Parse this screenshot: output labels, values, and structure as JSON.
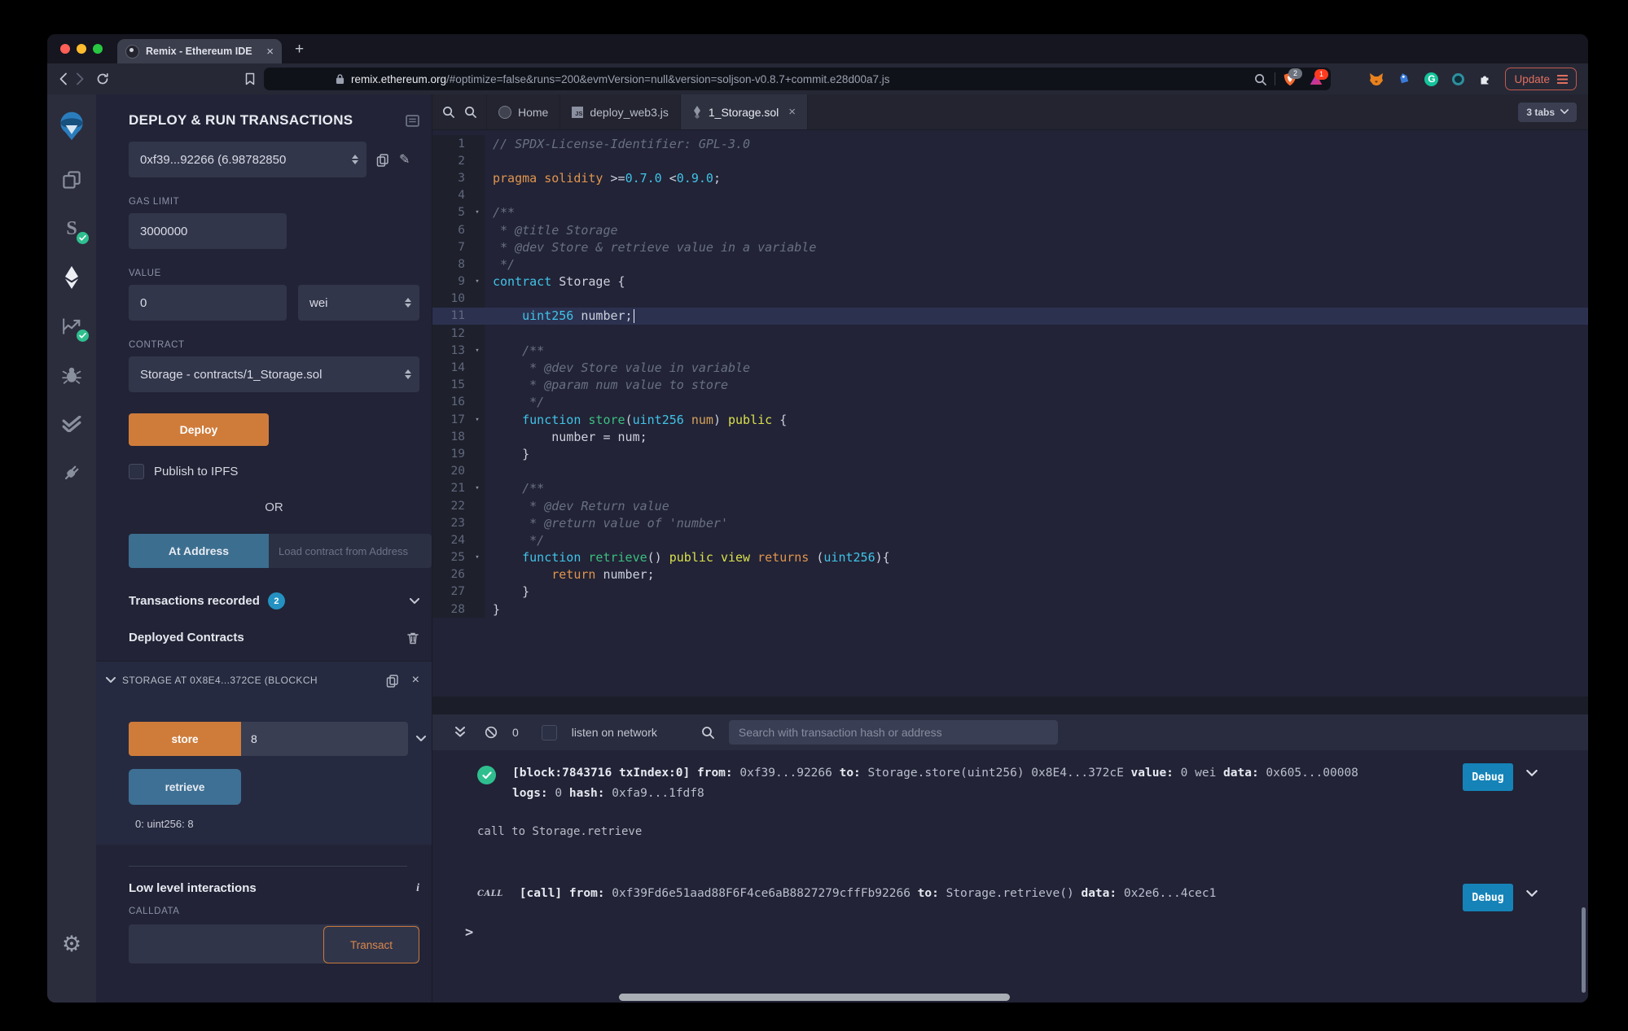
{
  "browser": {
    "traffic_lights": [
      "#ff5f57",
      "#febc2e",
      "#28c840"
    ],
    "tab_title": "Remix - Ethereum IDE",
    "tab_close": "×",
    "new_tab": "+",
    "url": {
      "domain": "remix.ethereum.org",
      "path": "/#optimize=false&runs=200&evmVersion=null&version=soljson-v0.8.7+commit.e28d00a7.js"
    },
    "shield_badge": "2",
    "triangle_badge": "1",
    "update_label": "Update"
  },
  "rail": {
    "icons": [
      "remix-logo",
      "file-explorer",
      "solidity-compiler",
      "deploy-and-run",
      "solidity-static-analysis",
      "debugger",
      "solidity-unit-testing",
      "plugin-manager",
      "settings"
    ]
  },
  "panel": {
    "title": "DEPLOY & RUN TRANSACTIONS",
    "account_value": "0xf39...92266 (6.98782850",
    "gas_label": "GAS LIMIT",
    "gas_value": "3000000",
    "value_label": "VALUE",
    "value_value": "0",
    "unit_value": "wei",
    "contract_label": "CONTRACT",
    "contract_value": "Storage - contracts/1_Storage.sol",
    "deploy_label": "Deploy",
    "publish_label": "Publish to IPFS",
    "or_label": "OR",
    "at_address_label": "At Address",
    "at_address_placeholder": "Load contract from Address",
    "tx_recorded_label": "Transactions recorded",
    "tx_recorded_count": "2",
    "deployed_label": "Deployed Contracts",
    "deployed_contract_title": "STORAGE AT 0X8E4...372CE (BLOCKCH",
    "store_label": "store",
    "store_value": "8",
    "retrieve_label": "retrieve",
    "retrieve_result": "0: uint256: 8",
    "low_level_label": "Low level interactions",
    "calldata_label": "CALLDATA",
    "transact_label": "Transact"
  },
  "editor": {
    "tabs": [
      {
        "label": "Home"
      },
      {
        "label": "deploy_web3.js"
      },
      {
        "label": "1_Storage.sol"
      }
    ],
    "tabs_badge": "3 tabs",
    "code_lines": [
      {
        "n": 1,
        "fold": false,
        "hl": false,
        "tokens": [
          {
            "t": "// SPDX-License-Identifier: GPL-3.0",
            "c": "com"
          }
        ]
      },
      {
        "n": 2,
        "fold": false,
        "hl": false,
        "tokens": []
      },
      {
        "n": 3,
        "fold": false,
        "hl": false,
        "tokens": [
          {
            "t": "pragma solidity ",
            "c": "orn"
          },
          {
            "t": ">=",
            "c": "wht"
          },
          {
            "t": "0.7.0 ",
            "c": "cyn"
          },
          {
            "t": "<",
            "c": "wht"
          },
          {
            "t": "0.9.0",
            "c": "cyn"
          },
          {
            "t": ";",
            "c": "wht"
          }
        ]
      },
      {
        "n": 4,
        "fold": false,
        "hl": false,
        "tokens": []
      },
      {
        "n": 5,
        "fold": true,
        "hl": false,
        "tokens": [
          {
            "t": "/**",
            "c": "com"
          }
        ]
      },
      {
        "n": 6,
        "fold": false,
        "hl": false,
        "tokens": [
          {
            "t": " * @title Storage",
            "c": "com"
          }
        ]
      },
      {
        "n": 7,
        "fold": false,
        "hl": false,
        "tokens": [
          {
            "t": " * @dev Store & retrieve value in a variable",
            "c": "com"
          }
        ]
      },
      {
        "n": 8,
        "fold": false,
        "hl": false,
        "tokens": [
          {
            "t": " */",
            "c": "com"
          }
        ]
      },
      {
        "n": 9,
        "fold": true,
        "hl": false,
        "tokens": [
          {
            "t": "contract",
            "c": "cyn"
          },
          {
            "t": " Storage {",
            "c": "wht"
          }
        ]
      },
      {
        "n": 10,
        "fold": false,
        "hl": false,
        "tokens": []
      },
      {
        "n": 11,
        "fold": false,
        "hl": true,
        "cursor": true,
        "tokens": [
          {
            "t": "    uint256",
            "c": "cyn"
          },
          {
            "t": " number;",
            "c": "wht"
          }
        ]
      },
      {
        "n": 12,
        "fold": false,
        "hl": false,
        "tokens": []
      },
      {
        "n": 13,
        "fold": true,
        "hl": false,
        "tokens": [
          {
            "t": "    /**",
            "c": "com"
          }
        ]
      },
      {
        "n": 14,
        "fold": false,
        "hl": false,
        "tokens": [
          {
            "t": "     * @dev Store value in variable",
            "c": "com"
          }
        ]
      },
      {
        "n": 15,
        "fold": false,
        "hl": false,
        "tokens": [
          {
            "t": "     * @param num value to store",
            "c": "com"
          }
        ]
      },
      {
        "n": 16,
        "fold": false,
        "hl": false,
        "tokens": [
          {
            "t": "     */",
            "c": "com"
          }
        ]
      },
      {
        "n": 17,
        "fold": true,
        "hl": false,
        "tokens": [
          {
            "t": "    function",
            "c": "cyn"
          },
          {
            "t": " store",
            "c": "grn"
          },
          {
            "t": "(",
            "c": "wht"
          },
          {
            "t": "uint256",
            "c": "cyn"
          },
          {
            "t": " num",
            "c": "par"
          },
          {
            "t": ") ",
            "c": "wht"
          },
          {
            "t": "public",
            "c": "mod"
          },
          {
            "t": " {",
            "c": "wht"
          }
        ]
      },
      {
        "n": 18,
        "fold": false,
        "hl": false,
        "tokens": [
          {
            "t": "        number = num;",
            "c": "wht"
          }
        ]
      },
      {
        "n": 19,
        "fold": false,
        "hl": false,
        "tokens": [
          {
            "t": "    }",
            "c": "wht"
          }
        ]
      },
      {
        "n": 20,
        "fold": false,
        "hl": false,
        "tokens": []
      },
      {
        "n": 21,
        "fold": true,
        "hl": false,
        "tokens": [
          {
            "t": "    /**",
            "c": "com"
          }
        ]
      },
      {
        "n": 22,
        "fold": false,
        "hl": false,
        "tokens": [
          {
            "t": "     * @dev Return value",
            "c": "com"
          }
        ]
      },
      {
        "n": 23,
        "fold": false,
        "hl": false,
        "tokens": [
          {
            "t": "     * @return value of 'number'",
            "c": "com"
          }
        ]
      },
      {
        "n": 24,
        "fold": false,
        "hl": false,
        "tokens": [
          {
            "t": "     */",
            "c": "com"
          }
        ]
      },
      {
        "n": 25,
        "fold": true,
        "hl": false,
        "tokens": [
          {
            "t": "    function",
            "c": "cyn"
          },
          {
            "t": " retrieve",
            "c": "grn"
          },
          {
            "t": "() ",
            "c": "wht"
          },
          {
            "t": "public",
            "c": "mod"
          },
          {
            "t": " ",
            "c": "wht"
          },
          {
            "t": "view",
            "c": "mod"
          },
          {
            "t": " returns",
            "c": "orn"
          },
          {
            "t": " (",
            "c": "wht"
          },
          {
            "t": "uint256",
            "c": "cyn"
          },
          {
            "t": "){",
            "c": "wht"
          }
        ]
      },
      {
        "n": 26,
        "fold": false,
        "hl": false,
        "tokens": [
          {
            "t": "        return",
            "c": "orn"
          },
          {
            "t": " number;",
            "c": "wht"
          }
        ]
      },
      {
        "n": 27,
        "fold": false,
        "hl": false,
        "tokens": [
          {
            "t": "    }",
            "c": "wht"
          }
        ]
      },
      {
        "n": 28,
        "fold": false,
        "hl": false,
        "tokens": [
          {
            "t": "}",
            "c": "wht"
          }
        ]
      }
    ]
  },
  "terminal": {
    "block_count": "0",
    "listen_label": "listen on network",
    "search_placeholder": "Search with transaction hash or address",
    "tx1": {
      "line1": [
        {
          "t": "[block:7843716 txIndex:0] ",
          "b": true
        },
        {
          "t": "from:",
          "b": true
        },
        {
          "t": " 0xf39...92266 ",
          "b": false
        },
        {
          "t": "to:",
          "b": true
        },
        {
          "t": " Storage.store(uint256) 0x8E4...372cE ",
          "b": false
        },
        {
          "t": "value:",
          "b": true
        },
        {
          "t": " 0 wei ",
          "b": false
        },
        {
          "t": "data:",
          "b": true
        },
        {
          "t": " 0x605...00008 ",
          "b": false
        }
      ],
      "line2": [
        {
          "t": "logs:",
          "b": true
        },
        {
          "t": " 0 ",
          "b": false
        },
        {
          "t": "hash:",
          "b": true
        },
        {
          "t": " 0xfa9...1fdf8",
          "b": false
        }
      ],
      "debug_label": "Debug"
    },
    "call_line": "call to Storage.retrieve",
    "tx2": {
      "badge": "CALL",
      "line1": [
        {
          "t": "[call] ",
          "b": true
        },
        {
          "t": "from:",
          "b": true
        },
        {
          "t": " 0xf39Fd6e51aad88F6F4ce6aB8827279cffFb92266 ",
          "b": false
        },
        {
          "t": "to:",
          "b": true
        },
        {
          "t": " Storage.retrieve() ",
          "b": false
        },
        {
          "t": "data:",
          "b": true
        },
        {
          "t": " 0x2e6...4cec1",
          "b": false
        }
      ],
      "debug_label": "Debug"
    },
    "prompt": ">"
  },
  "colors": {
    "accent_orange": "#cf7c3b",
    "steel_blue": "#3d7094",
    "debug_blue": "#1583b8",
    "badge_blue": "#2392c2",
    "success_green": "#2fbf8f",
    "update_red": "#e0705f",
    "panel_bg": "#222336",
    "rail_bg": "#2b2d3d"
  }
}
